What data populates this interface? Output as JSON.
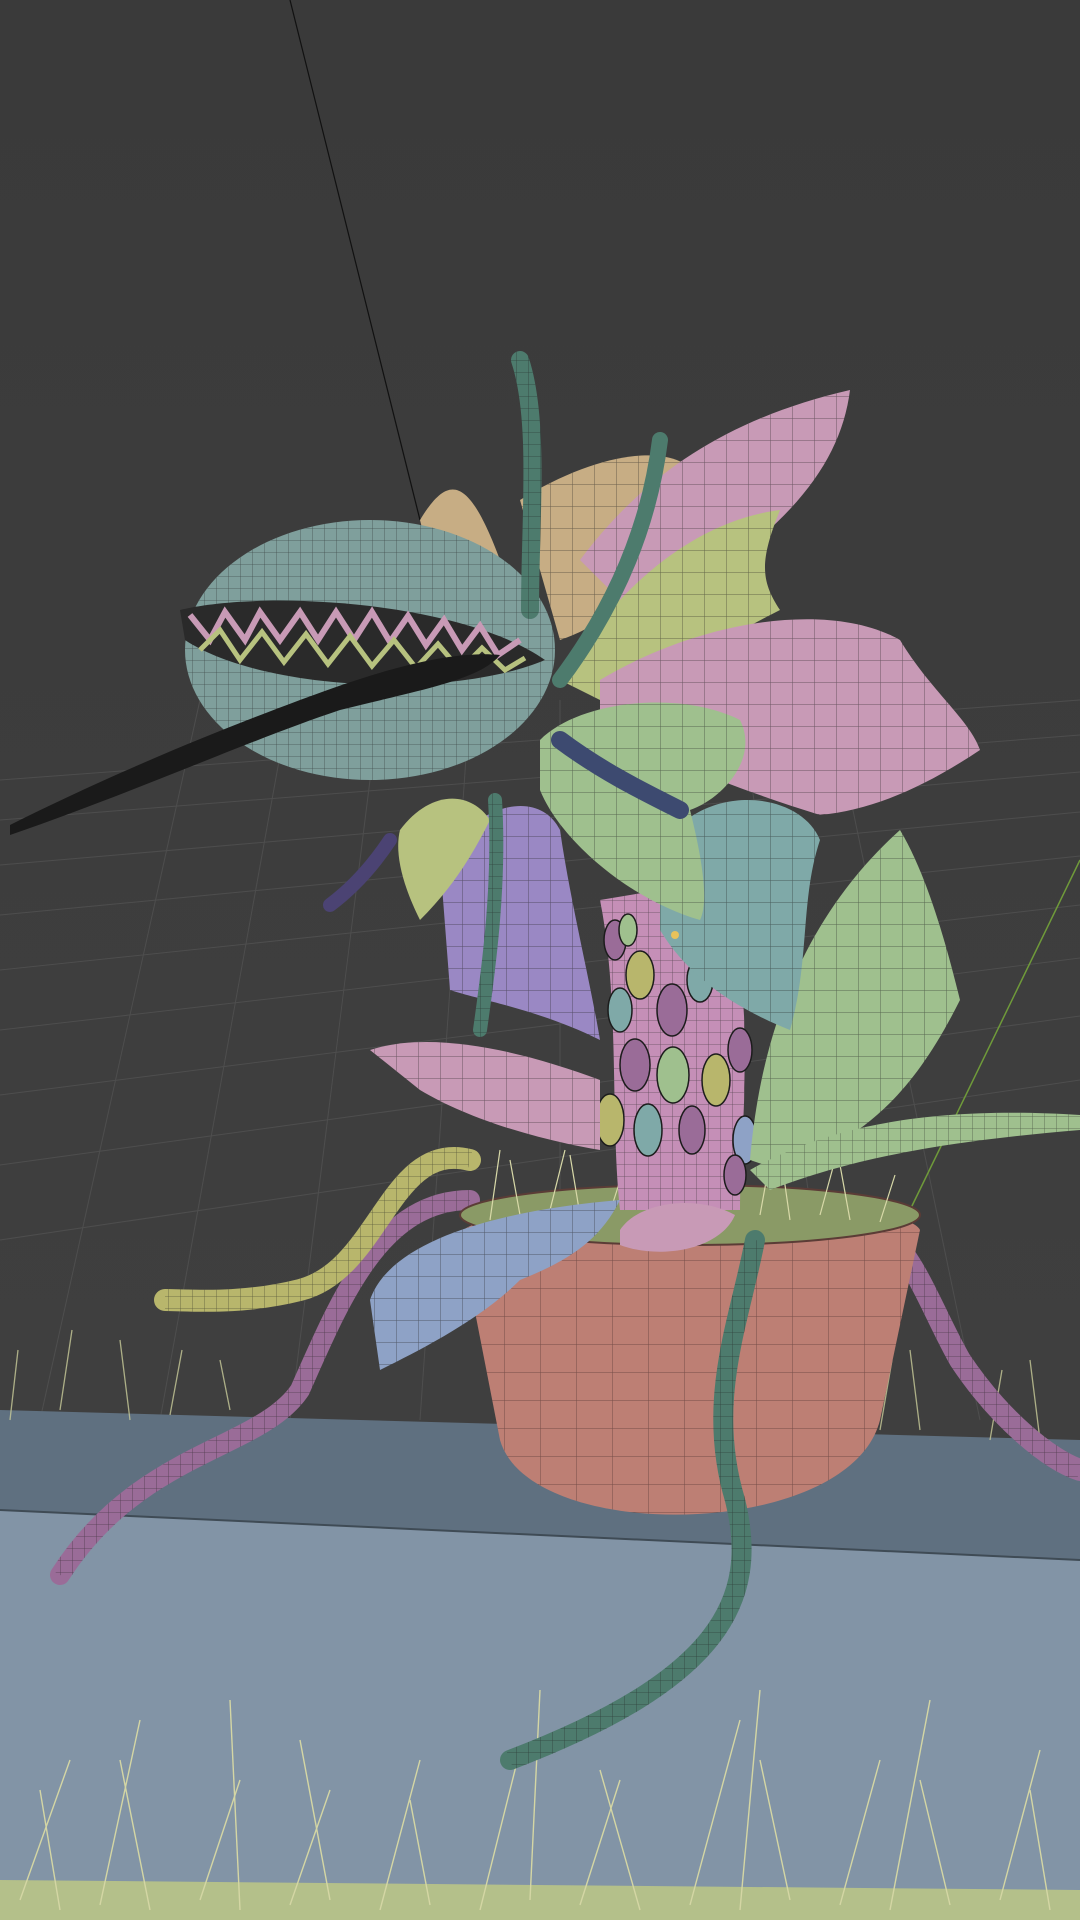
{
  "viewport": {
    "mode": "wireframe-overlay",
    "background_color": "#3d3d3d",
    "grid_line_color": "#545454",
    "shadow_catcher_color": "#8294a6",
    "ledge_color": "#5f7080",
    "ground_strip_color": "#b4c08a"
  },
  "scene_objects": [
    {
      "name": "pot",
      "color": "#bd7f74"
    },
    {
      "name": "head",
      "color": "#7f9f9c"
    },
    {
      "name": "tongue",
      "color": "#1a1a1a"
    },
    {
      "name": "stem",
      "color": "#c58fb7"
    },
    {
      "name": "leaf-pink",
      "color": "#c89ab6"
    },
    {
      "name": "leaf-green",
      "color": "#9fc08e"
    },
    {
      "name": "leaf-yellow",
      "color": "#b7c27f"
    },
    {
      "name": "leaf-purple",
      "color": "#9a88c4"
    },
    {
      "name": "leaf-teal",
      "color": "#7fa9a8"
    },
    {
      "name": "leaf-blue",
      "color": "#8ea2c6"
    },
    {
      "name": "leaf-orange",
      "color": "#c7ad84"
    },
    {
      "name": "vine-purple",
      "color": "#9a6c98"
    },
    {
      "name": "vine-green",
      "color": "#4d7b6d"
    },
    {
      "name": "vine-yellow",
      "color": "#b8b66c"
    },
    {
      "name": "grass",
      "color": "#c9cc9a"
    }
  ]
}
